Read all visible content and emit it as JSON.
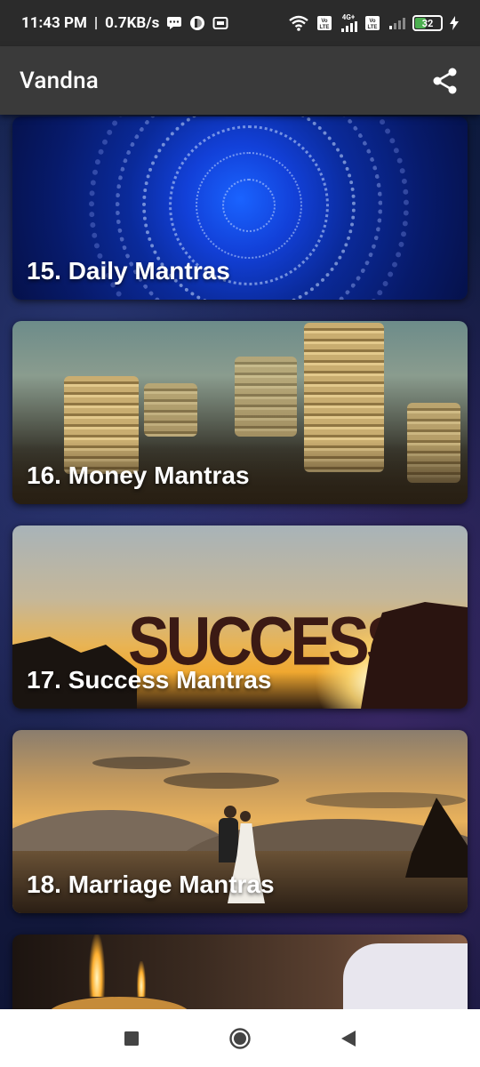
{
  "status_bar": {
    "time": "11:43 PM",
    "separator": "|",
    "speed": "0.7KB/s",
    "network_label": "4G+",
    "battery": "32"
  },
  "app_bar": {
    "title": "Vandna"
  },
  "cards": [
    {
      "label": "15. Daily Mantras"
    },
    {
      "label": "16. Money Mantras"
    },
    {
      "label": "17. Success Mantras"
    },
    {
      "label": "18. Marriage Mantras"
    }
  ],
  "images": {
    "success_word": "SUCCESS"
  },
  "colors": {
    "status_bar_bg": "#2b2b2b",
    "app_bar_bg": "#3a3a3a",
    "nav_bar_bg": "#ffffff"
  },
  "icons": {
    "share": "share-icon",
    "nav_recent": "square-icon",
    "nav_home": "circle-icon",
    "nav_back": "triangle-back-icon"
  }
}
